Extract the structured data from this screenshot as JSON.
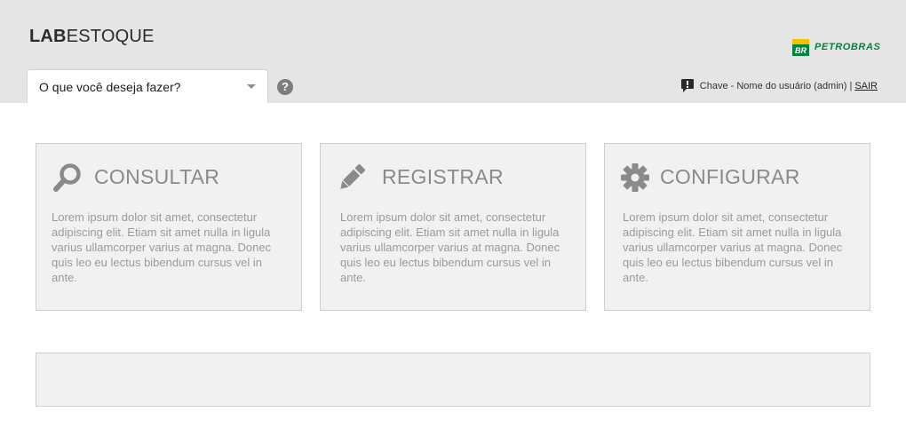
{
  "app": {
    "logo_strong": "LAB",
    "logo_light": "ESTOQUE"
  },
  "brand": {
    "name": "PETROBRAS",
    "mark_text": "BR",
    "colors": {
      "green": "#00843d",
      "yellow": "#f6c200"
    }
  },
  "action_select": {
    "value": "O que você deseja fazer?"
  },
  "help": {
    "icon": "question-circle-icon",
    "glyph": "?"
  },
  "user": {
    "icon": "alert-speech-icon",
    "label": "Chave - Nome do usuário (admin)",
    "separator": "|",
    "logout": "SAIR"
  },
  "cards": [
    {
      "icon": "search-icon",
      "title": "CONSULTAR",
      "text": "Lorem ipsum dolor sit amet, consectetur adipiscing elit. Etiam sit amet nulla in ligula varius ullamcorper varius at magna. Donec quis leo eu lectus bibendum cursus vel in ante."
    },
    {
      "icon": "pencil-icon",
      "title": "REGISTRAR",
      "text": "Lorem ipsum dolor sit amet, consectetur adipiscing elit. Etiam sit amet nulla in ligula varius ullamcorper varius at magna. Donec quis leo eu lectus bibendum cursus vel in ante."
    },
    {
      "icon": "gear-icon",
      "title": "CONFIGURAR",
      "text": "Lorem ipsum dolor sit amet, consectetur adipiscing elit. Etiam sit amet nulla in ligula varius ullamcorper varius at magna. Donec quis leo eu lectus bibendum cursus vel in ante."
    }
  ],
  "colors": {
    "header_bg": "#e5e5e5",
    "card_bg": "#f1f1f1",
    "card_border": "#cfcfcf",
    "muted_text": "#8a8a8a"
  }
}
